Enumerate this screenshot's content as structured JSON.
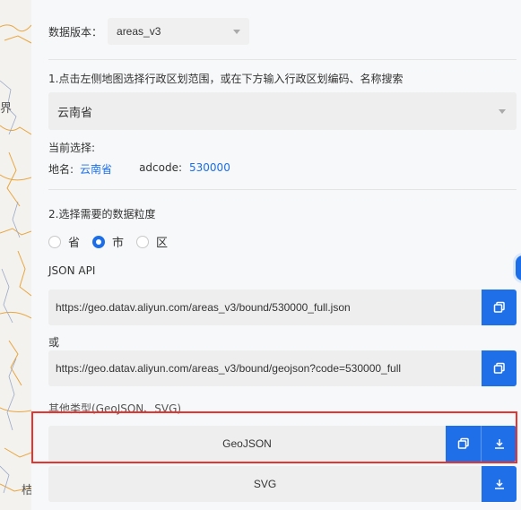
{
  "map": {
    "label_top": "界",
    "label_bottom": "桔"
  },
  "version": {
    "label": "数据版本：",
    "value": "areas_v3"
  },
  "step1": {
    "text": "1.点击左侧地图选择行政区划范围，或在下方输入行政区划编码、名称搜索",
    "select_value": "云南省"
  },
  "current": {
    "label": "当前选择:",
    "name_label": "地名:",
    "name_value": "云南省",
    "adcode_label": "adcode:",
    "adcode_value": "530000"
  },
  "step2": {
    "text": "2.选择需要的数据粒度",
    "options": [
      "省",
      "市",
      "区"
    ],
    "selected": "市"
  },
  "api": {
    "label": "JSON API",
    "url1": "https://geo.datav.aliyun.com/areas_v3/bound/530000_full.json",
    "or_label": "或",
    "url2": "https://geo.datav.aliyun.com/areas_v3/bound/geojson?code=530000_full"
  },
  "other": {
    "label": "其他类型(GeoJSON、SVG)",
    "geojson_label": "GeoJSON",
    "svg_label": "SVG"
  },
  "colors": {
    "accent": "#1f6fe8",
    "highlight": "#e8332e"
  }
}
